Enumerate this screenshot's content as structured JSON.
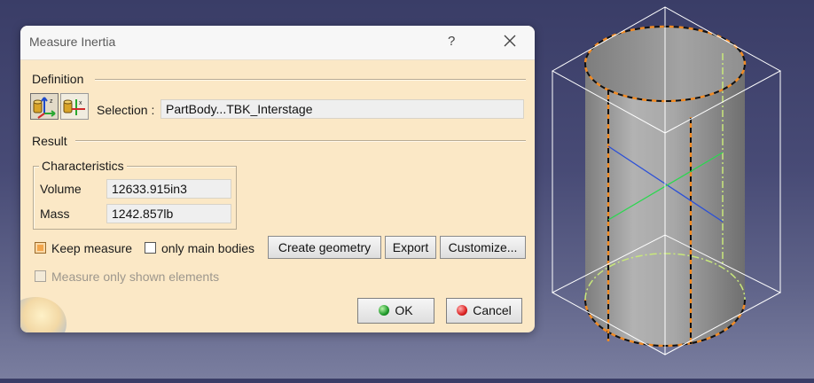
{
  "dialog": {
    "title": "Measure Inertia",
    "help_label": "?",
    "definition_label": "Definition",
    "selection_label": "Selection :",
    "selection_value": "PartBody...TBK_Interstage",
    "result_label": "Result",
    "characteristics": {
      "title": "Characteristics",
      "rows": [
        {
          "label": "Volume",
          "value": "12633.915in3"
        },
        {
          "label": "Mass",
          "value": "1242.857lb"
        }
      ]
    },
    "keep_measure_label": "Keep measure",
    "keep_measure_checked": true,
    "only_main_bodies_label": "only main bodies",
    "only_main_bodies_checked": false,
    "create_geometry_label": "Create geometry",
    "export_label": "Export",
    "customize_label": "Customize...",
    "measure_shown_label": "Measure only shown elements",
    "measure_shown_enabled": false,
    "ok_label": "OK",
    "cancel_label": "Cancel"
  },
  "icons": {
    "mode_1": "inertia-3d-icon",
    "mode_2": "inertia-2d-icon",
    "close": "close-icon",
    "ok": "green-ball-icon",
    "cancel": "red-ball-icon"
  },
  "colors": {
    "dialog_bg": "#fbe8c6",
    "highlight_orange": "#f08a24",
    "viewport_bg_top": "#3a3d67",
    "viewport_bg_bottom": "#7a7e9f"
  }
}
